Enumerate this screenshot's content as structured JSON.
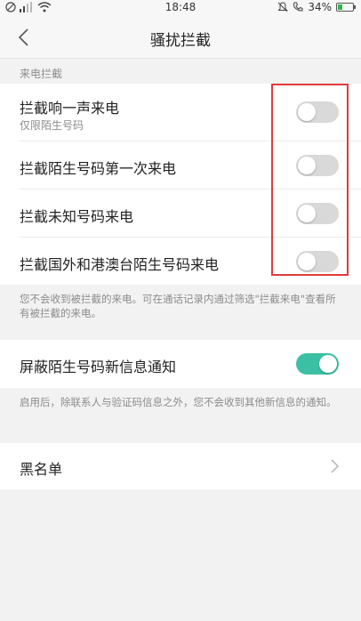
{
  "status_bar": {
    "time": "18:48",
    "battery_text": "34%",
    "battery_level": 0.34
  },
  "header": {
    "title": "骚扰拦截"
  },
  "section": {
    "incoming_title": "来电拦截"
  },
  "call_block_items": [
    {
      "title": "拦截响一声来电",
      "subtitle": "仅限陌生号码",
      "enabled": false
    },
    {
      "title": "拦截陌生号码第一次来电",
      "enabled": false
    },
    {
      "title": "拦截未知号码来电",
      "enabled": false
    },
    {
      "title": "拦截国外和港澳台陌生号码来电",
      "enabled": false
    }
  ],
  "call_note": "您不会收到被拦截的来电。可在通话记录内通过筛选\"拦截来电\"查看所有被拦截的来电。",
  "message_block": {
    "title": "屏蔽陌生号码新信息通知",
    "enabled": true,
    "note": "启用后，除联系人与验证码信息之外，您不会收到其他新信息的通知。"
  },
  "blacklist": {
    "title": "黑名单"
  },
  "colors": {
    "toggle_on": "#3cc0a3",
    "toggle_off": "#d9d9d9",
    "highlight": "#e23b3b"
  }
}
